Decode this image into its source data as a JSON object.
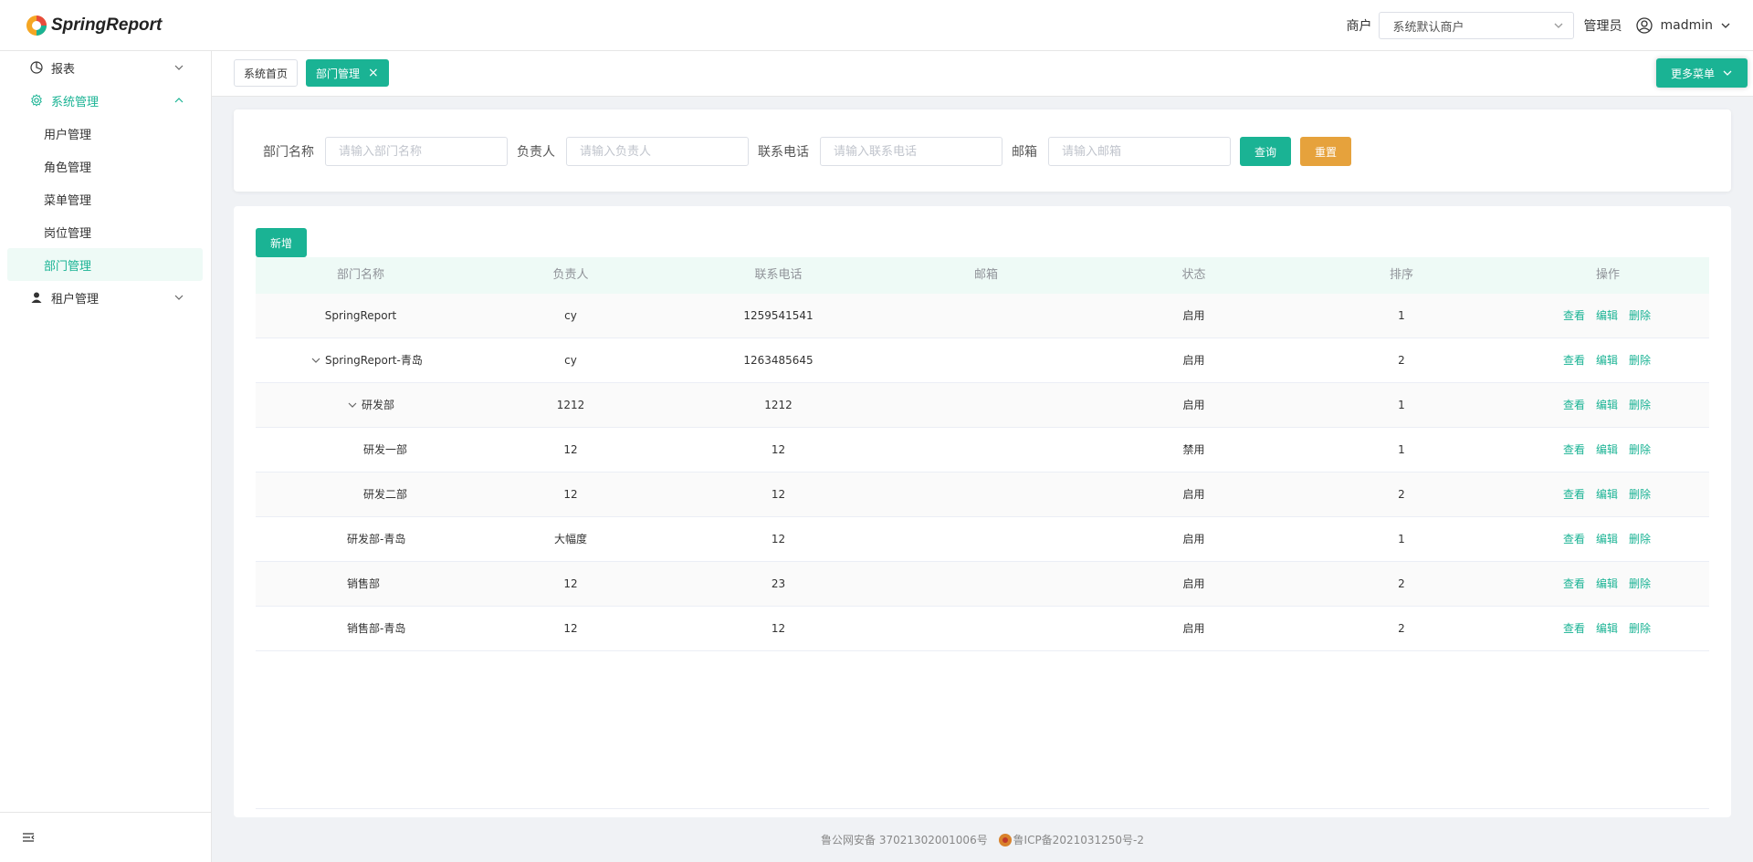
{
  "app": {
    "logo_text": "SpringReport"
  },
  "header": {
    "tenant_label": "商户",
    "tenant_value": "系统默认商户",
    "role_label": "管理员",
    "user_name": "madmin"
  },
  "sidebar": {
    "menu": [
      {
        "label": "报表",
        "icon": "pie-chart-icon"
      },
      {
        "label": "系统管理",
        "icon": "gear-icon"
      },
      {
        "label": "租户管理",
        "icon": "user-icon"
      }
    ],
    "submenu": [
      "用户管理",
      "角色管理",
      "菜单管理",
      "岗位管理",
      "部门管理"
    ]
  },
  "tabs": [
    {
      "label": "系统首页"
    },
    {
      "label": "部门管理",
      "close": "×"
    }
  ],
  "more_menu_label": "更多菜单",
  "search": {
    "fields": [
      {
        "label": "部门名称",
        "placeholder": "请输入部门名称"
      },
      {
        "label": "负责人",
        "placeholder": "请输入负责人"
      },
      {
        "label": "联系电话",
        "placeholder": "请输入联系电话"
      },
      {
        "label": "邮箱",
        "placeholder": "请输入邮箱"
      }
    ],
    "query_label": "查询",
    "reset_label": "重置"
  },
  "table": {
    "add_label": "新增",
    "headers": [
      "部门名称",
      "负责人",
      "联系电话",
      "邮箱",
      "状态",
      "排序",
      "操作"
    ],
    "actions": [
      "查看",
      "编辑",
      "删除"
    ],
    "rows": [
      {
        "name": "SpringReport",
        "leader": "cy",
        "phone": "1259541541",
        "email": "",
        "status": "启用",
        "order": "1",
        "level": 0,
        "expand": false
      },
      {
        "name": "SpringReport-青岛",
        "leader": "cy",
        "phone": "1263485645",
        "email": "",
        "status": "启用",
        "order": "2",
        "level": 0,
        "expand": true
      },
      {
        "name": "研发部",
        "leader": "1212",
        "phone": "1212",
        "email": "",
        "status": "启用",
        "order": "1",
        "level": 1,
        "expand": true
      },
      {
        "name": "研发一部",
        "leader": "12",
        "phone": "12",
        "email": "",
        "status": "禁用",
        "order": "1",
        "level": 2,
        "expand": false
      },
      {
        "name": "研发二部",
        "leader": "12",
        "phone": "12",
        "email": "",
        "status": "启用",
        "order": "2",
        "level": 2,
        "expand": false
      },
      {
        "name": "研发部-青岛",
        "leader": "大幅度",
        "phone": "12",
        "email": "",
        "status": "启用",
        "order": "1",
        "level": 1,
        "expand": false
      },
      {
        "name": "销售部",
        "leader": "12",
        "phone": "23",
        "email": "",
        "status": "启用",
        "order": "2",
        "level": 1,
        "expand": false
      },
      {
        "name": "销售部-青岛",
        "leader": "12",
        "phone": "12",
        "email": "",
        "status": "启用",
        "order": "2",
        "level": 1,
        "expand": false
      }
    ]
  },
  "footer": {
    "police_record": "鲁公网安备 37021302001006号",
    "icp_record": "鲁ICP备2021031250号-2"
  },
  "colors": {
    "accent": "#1ab394",
    "warning": "#e6a23c"
  }
}
